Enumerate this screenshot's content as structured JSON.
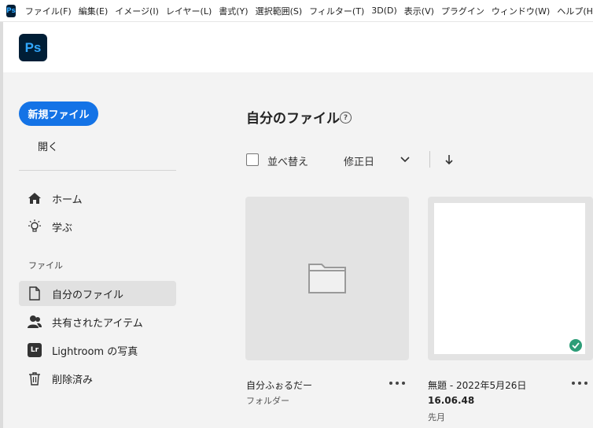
{
  "menubar": {
    "app_icon": "Ps",
    "items": [
      {
        "label": "ファイル(F)"
      },
      {
        "label": "編集(E)"
      },
      {
        "label": "イメージ(I)"
      },
      {
        "label": "レイヤー(L)"
      },
      {
        "label": "書式(Y)"
      },
      {
        "label": "選択範囲(S)"
      },
      {
        "label": "フィルター(T)"
      },
      {
        "label": "3D(D)"
      },
      {
        "label": "表示(V)"
      },
      {
        "label": "プラグイン"
      },
      {
        "label": "ウィンドウ(W)"
      },
      {
        "label": "ヘルプ(H)"
      }
    ]
  },
  "header": {
    "logo_text": "Ps",
    "logo_icon": "photoshop-logo"
  },
  "sidebar": {
    "new_file_label": "新規ファイル",
    "open_label": "開く",
    "nav_top": [
      {
        "label": "ホーム",
        "icon": "home-icon"
      },
      {
        "label": "学ぶ",
        "icon": "lightbulb-icon"
      }
    ],
    "section_label": "ファイル",
    "nav_files": [
      {
        "label": "自分のファイル",
        "icon": "document-icon",
        "active": true
      },
      {
        "label": "共有されたアイテム",
        "icon": "people-icon",
        "active": false
      },
      {
        "label": "Lightroom の写真",
        "icon": "lightroom-icon",
        "icon_text": "Lr",
        "active": false
      },
      {
        "label": "削除済み",
        "icon": "trash-icon",
        "active": false
      }
    ]
  },
  "main": {
    "title": "自分のファイル",
    "help_icon": "?",
    "sort": {
      "checkbox_label": "並べ替え",
      "field": "修正日",
      "direction": "descending"
    },
    "files": [
      {
        "name": "自分ふぉるだー",
        "type_label": "フォルダー",
        "kind": "folder"
      },
      {
        "name": "無題 - 2022年5月26日",
        "time": "16.06.48",
        "modified": "先月",
        "kind": "document",
        "synced": true
      }
    ]
  },
  "colors": {
    "accent": "#1473e6",
    "ps_logo_bg": "#001e36",
    "ps_logo_fg": "#31a8ff",
    "sync_green": "#2d9d78"
  }
}
